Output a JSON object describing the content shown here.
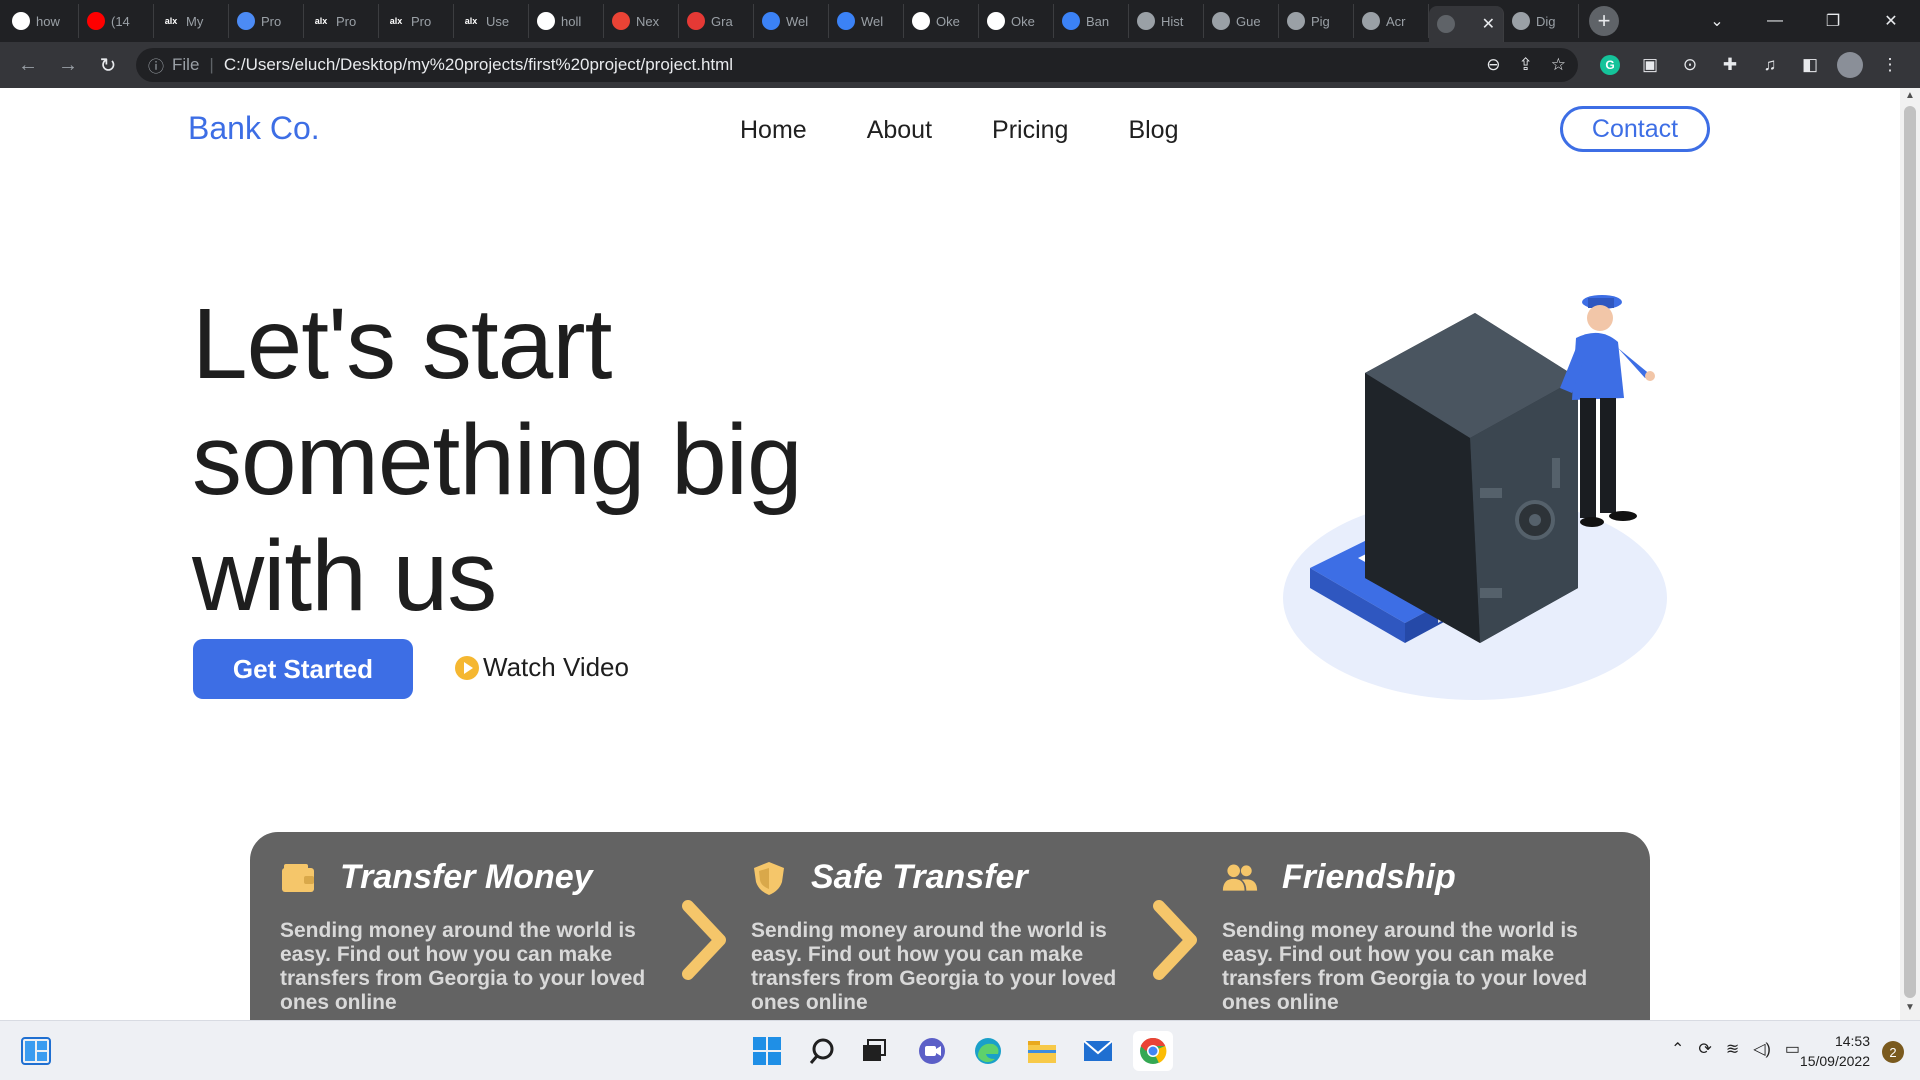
{
  "browser": {
    "tabs": [
      {
        "label": "how",
        "icon": "google-icon",
        "color": "#ffffff"
      },
      {
        "label": "(14",
        "icon": "youtube-icon",
        "color": "#ff0000"
      },
      {
        "label": "My",
        "icon": "alx-icon",
        "color": "#ffffff"
      },
      {
        "label": "Pro",
        "icon": "loading-icon",
        "color": "#4c8bf5"
      },
      {
        "label": "Pro",
        "icon": "alx-icon",
        "color": "#ffffff"
      },
      {
        "label": "Pro",
        "icon": "alx-icon",
        "color": "#ffffff"
      },
      {
        "label": "Use",
        "icon": "alx-icon",
        "color": "#ffffff"
      },
      {
        "label": "holl",
        "icon": "github-icon",
        "color": "#ffffff"
      },
      {
        "label": "Nex",
        "icon": "gmail-icon",
        "color": "#ea4335"
      },
      {
        "label": "Gra",
        "icon": "n-icon",
        "color": "#e53935"
      },
      {
        "label": "Wel",
        "icon": "gear-icon",
        "color": "#3b82f6"
      },
      {
        "label": "Wel",
        "icon": "gear-icon",
        "color": "#3b82f6"
      },
      {
        "label": "Oke",
        "icon": "github-icon",
        "color": "#ffffff"
      },
      {
        "label": "Oke",
        "icon": "github-icon",
        "color": "#ffffff"
      },
      {
        "label": "Ban",
        "icon": "d-icon",
        "color": "#3b82f6"
      },
      {
        "label": "Hist",
        "icon": "history-icon",
        "color": "#9aa0a6"
      },
      {
        "label": "Gue",
        "icon": "globe-icon",
        "color": "#9aa0a6"
      },
      {
        "label": "Pig",
        "icon": "globe-icon",
        "color": "#9aa0a6"
      },
      {
        "label": "Acr",
        "icon": "globe-icon",
        "color": "#9aa0a6"
      },
      {
        "label": "",
        "icon": "globe-icon",
        "color": "#9aa0a6",
        "active": true
      },
      {
        "label": "Dig",
        "icon": "globe-icon",
        "color": "#9aa0a6"
      }
    ],
    "address": {
      "scheme_label": "File",
      "url": "C:/Users/eluch/Desktop/my%20projects/first%20project/project.html"
    }
  },
  "site": {
    "brand": "Bank Co.",
    "nav": [
      "Home",
      "About",
      "Pricing",
      "Blog"
    ],
    "contact_label": "Contact",
    "hero": {
      "headline": "Let's start something big with us",
      "primary_cta": "Get Started",
      "secondary_cta": "Watch Video"
    },
    "features": [
      {
        "title": "Transfer Money",
        "icon": "wallet-icon",
        "desc": "Sending money around the world is easy. Find out how you can make transfers from Georgia to your loved ones online"
      },
      {
        "title": "Safe Transfer",
        "icon": "shield-icon",
        "desc": "Sending money around the world is easy. Find out how you can make transfers from Georgia to your loved ones online"
      },
      {
        "title": "Friendship",
        "icon": "users-icon",
        "desc": "Sending money around the world is easy. Find out how you can make transfers from Georgia to your loved ones online"
      }
    ],
    "colors": {
      "accent": "#3d6ee5",
      "feature_icon": "#f5c66a",
      "feature_bg": "#636363"
    }
  },
  "taskbar": {
    "time": "14:53",
    "date": "15/09/2022",
    "notifications": "2"
  }
}
